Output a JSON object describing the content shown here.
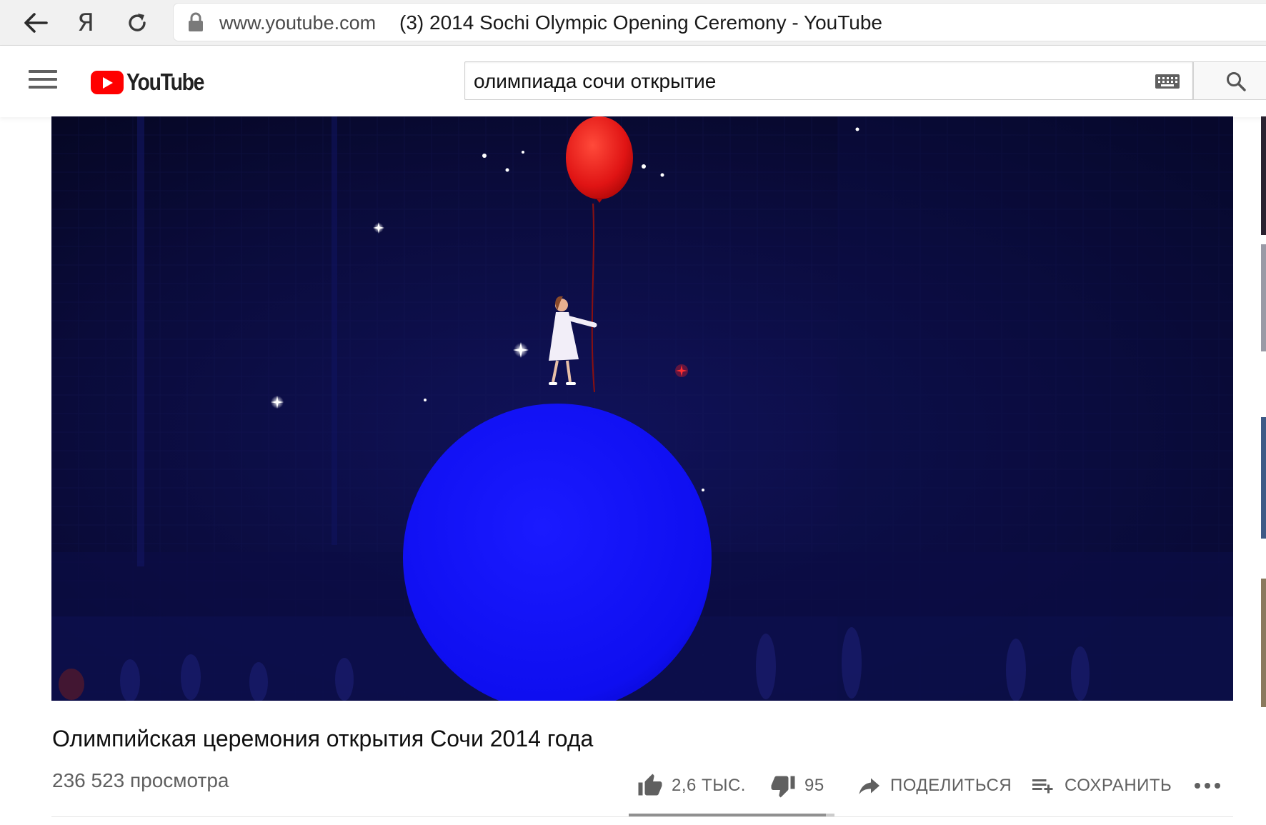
{
  "browser": {
    "domain": "www.youtube.com",
    "page_title": "(3) 2014 Sochi Olympic Opening Ceremony - YouTube",
    "yandex_glyph": "Я"
  },
  "masthead": {
    "logo_text": "YouTube",
    "search_query": "олимпиада сочи открытие"
  },
  "video": {
    "title": "Олимпийская церемония открытия Сочи 2014 года",
    "views": "236 523 просмотра",
    "likes": "2,6 ТЫС.",
    "dislikes": "95",
    "share_label": "ПОДЕЛИТЬСЯ",
    "save_label": "СОХРАНИТЬ",
    "like_fraction": 0.96
  },
  "colors": {
    "youtube_red": "#ff0000",
    "stage_background": "#07082a",
    "blue_sphere": "#1010ee",
    "red_balloon": "#e81818",
    "secondary_text": "#606060"
  }
}
